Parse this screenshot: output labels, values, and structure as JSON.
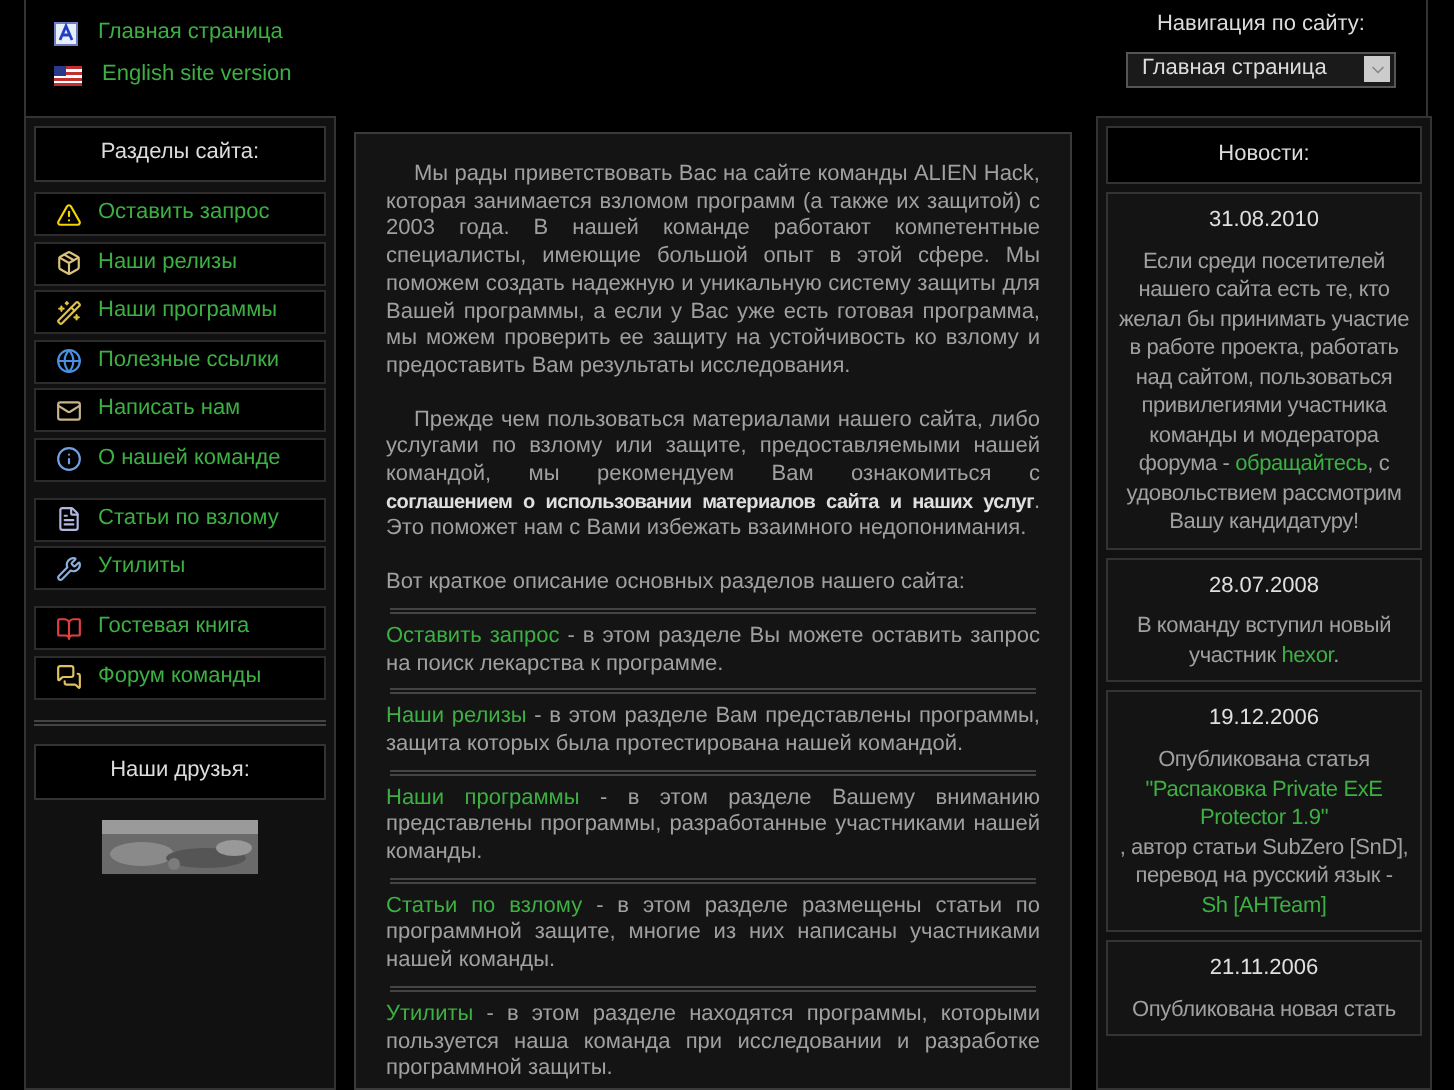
{
  "top_links": [
    {
      "label": "Главная страница",
      "kind": "home"
    },
    {
      "label": "English site version",
      "kind": "english"
    }
  ],
  "navigation": {
    "label": "Навигация по сайту:",
    "value": "Главная страница"
  },
  "sections": {
    "title": "Разделы сайта:",
    "groups": [
      [
        {
          "label": "Оставить запрос"
        },
        {
          "label": "Наши релизы"
        },
        {
          "label": "Наши программы"
        },
        {
          "label": "Полезные ссылки"
        },
        {
          "label": "Написать нам"
        },
        {
          "label": "О нашей команде"
        }
      ],
      [
        {
          "label": "Статьи по взлому"
        },
        {
          "label": "Утилиты"
        }
      ],
      [
        {
          "label": "Гостевая книга"
        },
        {
          "label": "Форум команды"
        }
      ]
    ]
  },
  "friends": {
    "title": "Наши друзья:"
  },
  "intro": [
    [
      {
        "text": "Мы рады приветствовать Вас на сайте команды ALIEN Hack, которая занимается взломом программ (а также их защитой) с 2003 года. В нашей команде работают компетентные специалисты, имеющие большой опыт в этой сфере. Мы поможем создать надежную и уникальную систему защиты для Вашей программы, а если у Вас уже есть готовая программа, мы можем проверить ее защиту на устойчивость ко взлому и предоставить Вам результаты исследования.",
        "kind": "text"
      }
    ],
    [
      {
        "text": "Прежде чем пользоваться материалами нашего сайта, либо услугами по взлому или защите, предоставляемыми нашей командой, мы рекомендуем Вам ознакомиться с",
        "kind": "text"
      },
      {
        "text": "соглашением о использовании материалов сайта и наших услуг",
        "kind": "link"
      },
      {
        "text": ". Это поможет нам с Вами избежать взаимного недопонимания.",
        "kind": "text"
      }
    ]
  ],
  "overview": "Вот краткое описание основных разделов нашего сайта:",
  "descriptions": [
    {
      "title": "Оставить запрос",
      "text": "- в этом разделе Вы можете оставить запрос на поиск лекарства к программе."
    },
    {
      "title": "Наши релизы",
      "text": "- в этом разделе Вам представлены программы, защита которых была протестирована нашей командой."
    },
    {
      "title": "Наши программы",
      "text": "- в этом разделе Вашему вниманию представлены программы, разработанные участниками нашей команды."
    },
    {
      "title": "Статьи по взлому",
      "text": "- в этом разделе размещены статьи по программной защите, многие из них написаны участниками нашей команды."
    },
    {
      "title": "Утилиты",
      "text": "- в этом разделе находятся программы, которыми пользуется наша команда при исследовании и разработке программной защиты."
    }
  ],
  "news": {
    "title": "Новости:",
    "items": [
      {
        "date": "31.08.2010",
        "parts": [
          {
            "text": "Если среди посетителей нашего сайта есть те, кто желал бы принимать участие в работе проекта, работать над сайтом, пользоваться привилегиями участника команды и модератора форума -",
            "kind": "text"
          },
          {
            "text": "обращайтесь",
            "kind": "link"
          },
          {
            "text": ", с удовольствием рассмотрим Вашу кандидатуру!",
            "kind": "text"
          }
        ]
      },
      {
        "date": "28.07.2008",
        "parts": [
          {
            "text": "В команду вступил новый участник",
            "kind": "text"
          },
          {
            "text": "hexor",
            "kind": "link"
          },
          {
            "text": ".",
            "kind": "text"
          }
        ]
      },
      {
        "date": "19.12.2006",
        "parts": [
          {
            "text": "Опубликована статья",
            "kind": "text"
          },
          {
            "text": "\"Распаковка Private ExE Protector 1.9\"",
            "kind": "block_link"
          },
          {
            "text": ", автор статьи SubZero [SnD], перевод на русский язык -",
            "kind": "text"
          },
          {
            "text": "Sh [AHTeam]",
            "kind": "link"
          }
        ]
      },
      {
        "date": "21.11.2006",
        "parts": [
          {
            "text": "Опубликована новая стать",
            "kind": "text"
          }
        ]
      }
    ]
  }
}
